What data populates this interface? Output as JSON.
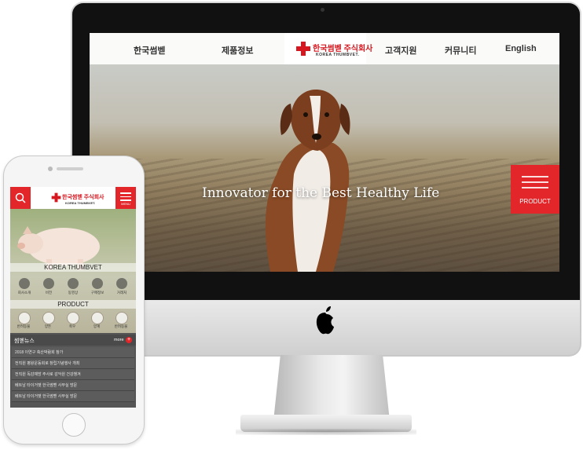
{
  "desktop": {
    "nav": [
      "한국썸벧",
      "제품정보",
      "고객지원",
      "커뮤니티",
      "English"
    ],
    "logo_text": "한국썸벧 주식회사",
    "logo_sub": "KOREA THUMBVET.",
    "tagline": "Innovator for the Best Healthy Life",
    "product_button": "PRODUCT"
  },
  "mobile": {
    "logo_text": "한국썸벧 주식회사",
    "logo_sub": "KOREA THUMBVET.",
    "menu_label": "MENU",
    "section1_title": "KOREA THUMBVET",
    "section1_items": [
      "회사소개",
      "비전",
      "동영상",
      "구매정보",
      "거래처"
    ],
    "section2_title": "PRODUCT",
    "section2_items": [
      "반려동물",
      "양돈",
      "축우",
      "양계",
      "반려동물"
    ],
    "news_title": "썸벧뉴스",
    "news_more": "more",
    "news_items": [
      "2018 이연구 축산박람회 참가",
      "전직원 평왕운동회로 창립기념행사 개최",
      "전직원 독감예방 주사로 감악원 건강챙겨",
      "베트남 타이거벳 한국썸벧 사무실 방문",
      "베트남 타이거벳 한국썸벧 사무실 방문"
    ]
  },
  "colors": {
    "brand_red": "#e2262a"
  }
}
